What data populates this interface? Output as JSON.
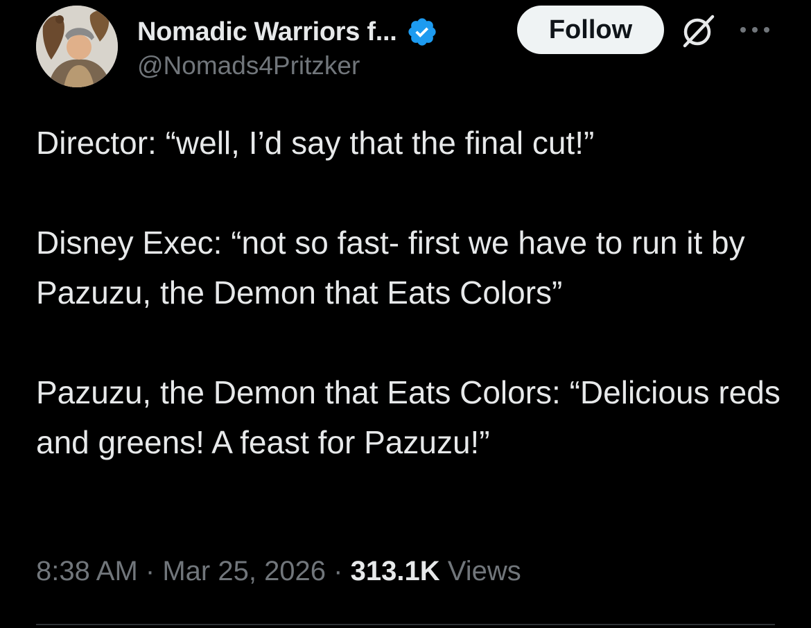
{
  "author": {
    "display_name": "Nomadic Warriors f...",
    "handle": "@Nomads4Pritzker",
    "verified": true,
    "verified_color": "#1d9bf0"
  },
  "actions": {
    "follow_label": "Follow",
    "grok_icon": "grok-icon",
    "more_icon": "more-dots-icon"
  },
  "tweet": {
    "paragraphs": [
      "Director: “well, I’d say that the final cut!”",
      "Disney Exec: “not so fast- first we have to run it by Pazuzu, the Demon that Eats Colors”",
      "Pazuzu, the Demon that Eats Colors: “Delicious reds and greens! A feast for Pazuzu!”"
    ]
  },
  "meta": {
    "time": "8:38 AM",
    "separator": "·",
    "date": "Mar 25, 2026",
    "views_count": "313.1K",
    "views_label": "Views"
  },
  "colors": {
    "background": "#000000",
    "text_primary": "#e7e9ea",
    "text_secondary": "#71767b",
    "follow_bg": "#eff3f4",
    "divider": "#2f3336"
  }
}
